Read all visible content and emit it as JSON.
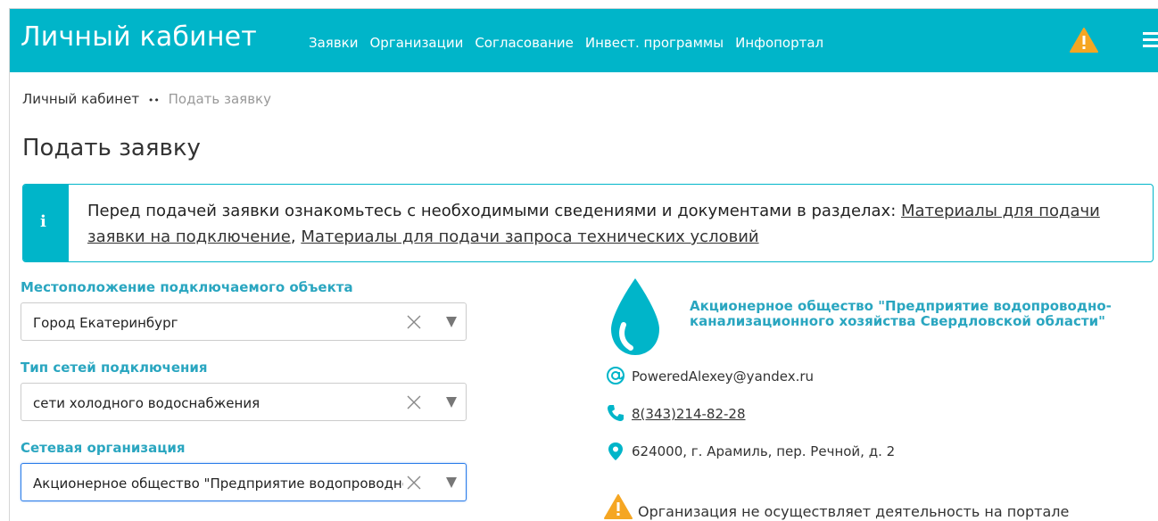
{
  "navbar": {
    "brand": "Личный кабинет",
    "links": [
      "Заявки",
      "Организации",
      "Согласование",
      "Инвест. программы",
      "Инфопортал"
    ],
    "accent_color": "#00b5c9"
  },
  "breadcrumb": {
    "home": "Личный кабинет",
    "separator": "••",
    "current": "Подать заявку"
  },
  "page": {
    "title": "Подать заявку"
  },
  "alert": {
    "icon": "i",
    "text_before": "Перед подачей заявки ознакомьтесь с необходимыми сведениями и документами в разделах: ",
    "link1": "Материалы для подачи заявки на подключение",
    "separator": ", ",
    "link2": "Материалы для подачи запроса технических условий"
  },
  "form": {
    "location_label": "Местоположение подключаемого объекта",
    "location_value": "Город Екатеринбург",
    "network_type_label": "Тип сетей подключения",
    "network_type_value": "сети холодного водоснабжения",
    "network_org_label": "Сетевая организация",
    "network_org_value": "Акционерное общество \"Предприятие водопроводно-канализационного хозяйства Свердловской области\""
  },
  "organization": {
    "name": "Акционерное общество \"Предприятие водопроводно-канализационного хозяйства Свердловской области\"",
    "email": "PoweredAlexey@yandex.ru",
    "phone": "8(343)214-82-28",
    "address": "624000, г. Арамиль, пер. Речной, д. 2",
    "warning": "Организация не осуществляет деятельность на портале",
    "logo_color": "#00b5c9"
  }
}
